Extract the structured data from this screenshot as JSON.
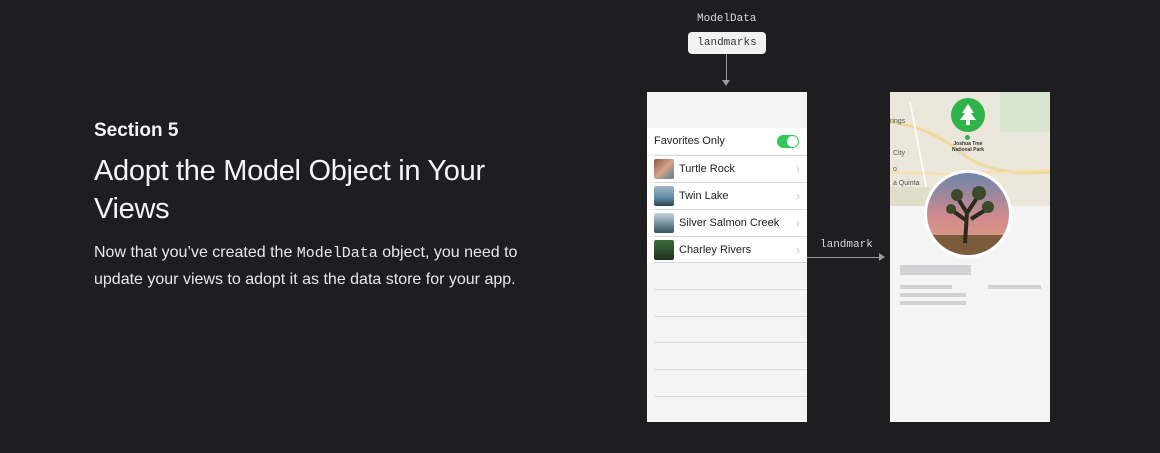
{
  "intro": {
    "eyebrow": "Section 5",
    "headline": "Adopt the Model Object in Your Views",
    "body_prefix": "Now that you’ve created the ",
    "body_code": "ModelData",
    "body_suffix": " object, you need to update your views to adopt it as the data store for your app."
  },
  "diagram": {
    "model_label": "ModelData",
    "property_label": "landmarks",
    "connection_label": "landmark",
    "list": {
      "toggle_label": "Favorites Only",
      "toggle_on": true,
      "rows": [
        {
          "label": "Turtle Rock"
        },
        {
          "label": "Twin Lake"
        },
        {
          "label": "Silver Salmon Creek"
        },
        {
          "label": "Charley Rivers"
        }
      ]
    },
    "detail": {
      "map_labels": [
        "rings",
        "City",
        "o",
        "a Quinta"
      ],
      "park_name_line1": "Joshua Tree",
      "park_name_line2": "National Park"
    }
  },
  "colors": {
    "background": "#1e1e20",
    "toggle": "#34c759",
    "pin": "#2fb34a"
  }
}
